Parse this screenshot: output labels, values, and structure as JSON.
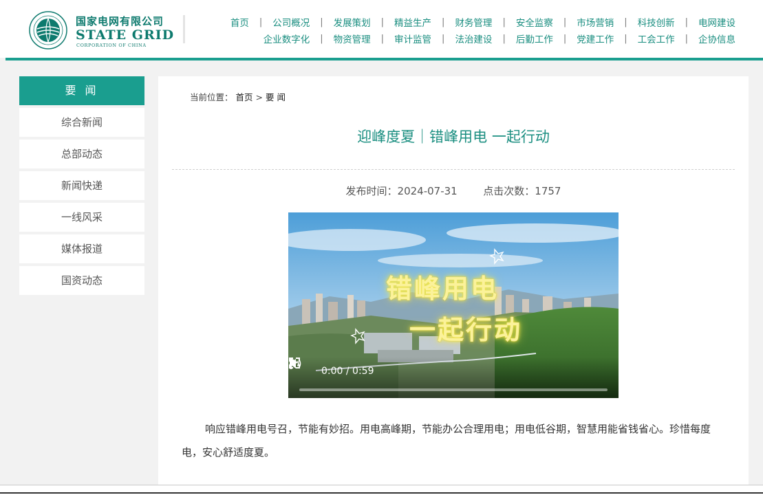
{
  "header": {
    "logo": {
      "cn_name": "国家电网有限公司",
      "en_name": "STATE GRID",
      "en_sub": "CORPORATION OF CHINA",
      "brand_color": "#0d7a6e"
    },
    "nav_row1": [
      "首页",
      "公司概况",
      "发展策划",
      "精益生产",
      "财务管理",
      "安全监察",
      "市场营销",
      "科技创新",
      "电网建设"
    ],
    "nav_row2": [
      "企业数字化",
      "物资管理",
      "审计监管",
      "法治建设",
      "后勤工作",
      "党建工作",
      "工会工作",
      "企协信息"
    ],
    "separator": "|",
    "accent_color": "#1a9e8f"
  },
  "sidebar": {
    "title": "要 闻",
    "items": [
      "综合新闻",
      "总部动态",
      "新闻快递",
      "一线风采",
      "媒体报道",
      "国资动态"
    ]
  },
  "breadcrumb": {
    "prefix": "当前位置：",
    "home": "首页",
    "separator": ">",
    "current": "要 闻"
  },
  "article": {
    "title": "迎峰度夏｜错峰用电 一起行动",
    "publish_label": "发布时间：",
    "publish_date": "2024-07-31",
    "views_label": "点击次数：",
    "views": "1757",
    "body": "响应错峰用电号召，节能有妙招。用电高峰期，节能办公合理用电；用电低谷期，智慧用能省钱省心。珍惜每度电，安心舒适度夏。"
  },
  "video": {
    "overlay_line1": "错峰用电",
    "overlay_line2": "一起行动",
    "time": "0:00 / 0:59",
    "progress": 0,
    "icons": [
      "play-icon",
      "volume-icon",
      "fullscreen-icon",
      "more-options-icon"
    ]
  }
}
